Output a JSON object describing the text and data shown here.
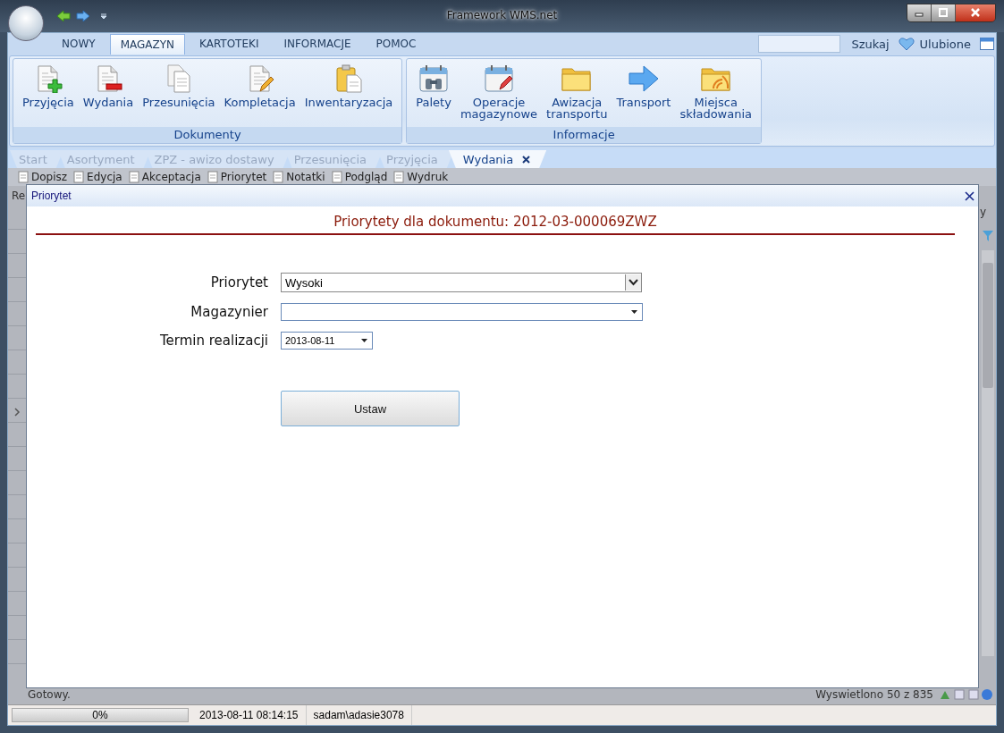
{
  "window": {
    "title": "Framework WMS.net"
  },
  "ribbon_tabs": [
    {
      "label": "NOWY",
      "selected": false
    },
    {
      "label": "MAGAZYN",
      "selected": true
    },
    {
      "label": "KARTOTEKI",
      "selected": false
    },
    {
      "label": "INFORMACJE",
      "selected": false
    },
    {
      "label": "POMOC",
      "selected": false
    }
  ],
  "search": {
    "button": "Szukaj"
  },
  "favorites": {
    "label": "Ulubione"
  },
  "ribbon_groups": [
    {
      "title": "Dokumenty",
      "items": [
        {
          "lines": [
            "Przyjęcia"
          ],
          "kind": "doc-plus"
        },
        {
          "lines": [
            "Wydania"
          ],
          "kind": "doc-minus"
        },
        {
          "lines": [
            "Przesunięcia"
          ],
          "kind": "docs"
        },
        {
          "lines": [
            "Kompletacja"
          ],
          "kind": "doc-pencil"
        },
        {
          "lines": [
            "Inwentaryzacja"
          ],
          "kind": "clipboard"
        }
      ]
    },
    {
      "title": "Informacje",
      "items": [
        {
          "lines": [
            "Palety"
          ],
          "kind": "calendar-binoculars"
        },
        {
          "lines": [
            "Operacje",
            "magazynowe"
          ],
          "kind": "calendar-pencil"
        },
        {
          "lines": [
            "Awizacja",
            "transportu"
          ],
          "kind": "folder"
        },
        {
          "lines": [
            "Transport"
          ],
          "kind": "arrow"
        },
        {
          "lines": [
            "Miejsca",
            "składowania"
          ],
          "kind": "folder-rss"
        }
      ]
    }
  ],
  "doc_tabs": [
    {
      "label": "Start",
      "selected": false
    },
    {
      "label": "Asortyment",
      "selected": false
    },
    {
      "label": "ZPZ - awizo dostawy",
      "selected": false
    },
    {
      "label": "Przesunięcia",
      "selected": false
    },
    {
      "label": "Przyjęcia",
      "selected": false
    },
    {
      "label": "Wydania",
      "selected": true
    }
  ],
  "toolbar": [
    "Dopisz",
    "Edycja",
    "Akceptacja",
    "Priorytet",
    "Notatki",
    "Podgląd",
    "Wydruk"
  ],
  "grid": {
    "column_1": "Re",
    "column_2": "y",
    "footer": "Gotowy.",
    "count": "Wyswietlono 50 z 835"
  },
  "dialog": {
    "title": "Priorytet",
    "heading": "Priorytety dla dokumentu: 2012-03-000069ZWZ",
    "fields": [
      {
        "label": "Priorytet",
        "kind": "select",
        "value": "Wysoki"
      },
      {
        "label": "Magazynier",
        "kind": "combo"
      },
      {
        "label": "Termin realizacji",
        "kind": "date",
        "value": "2013-08-11"
      }
    ],
    "button": "Ustaw"
  },
  "status_bar": {
    "progress": {
      "level": 0,
      "reading": "0%"
    },
    "datetime": "2013-08-11 08:14:15",
    "user": "sadam\\adasie3078"
  }
}
